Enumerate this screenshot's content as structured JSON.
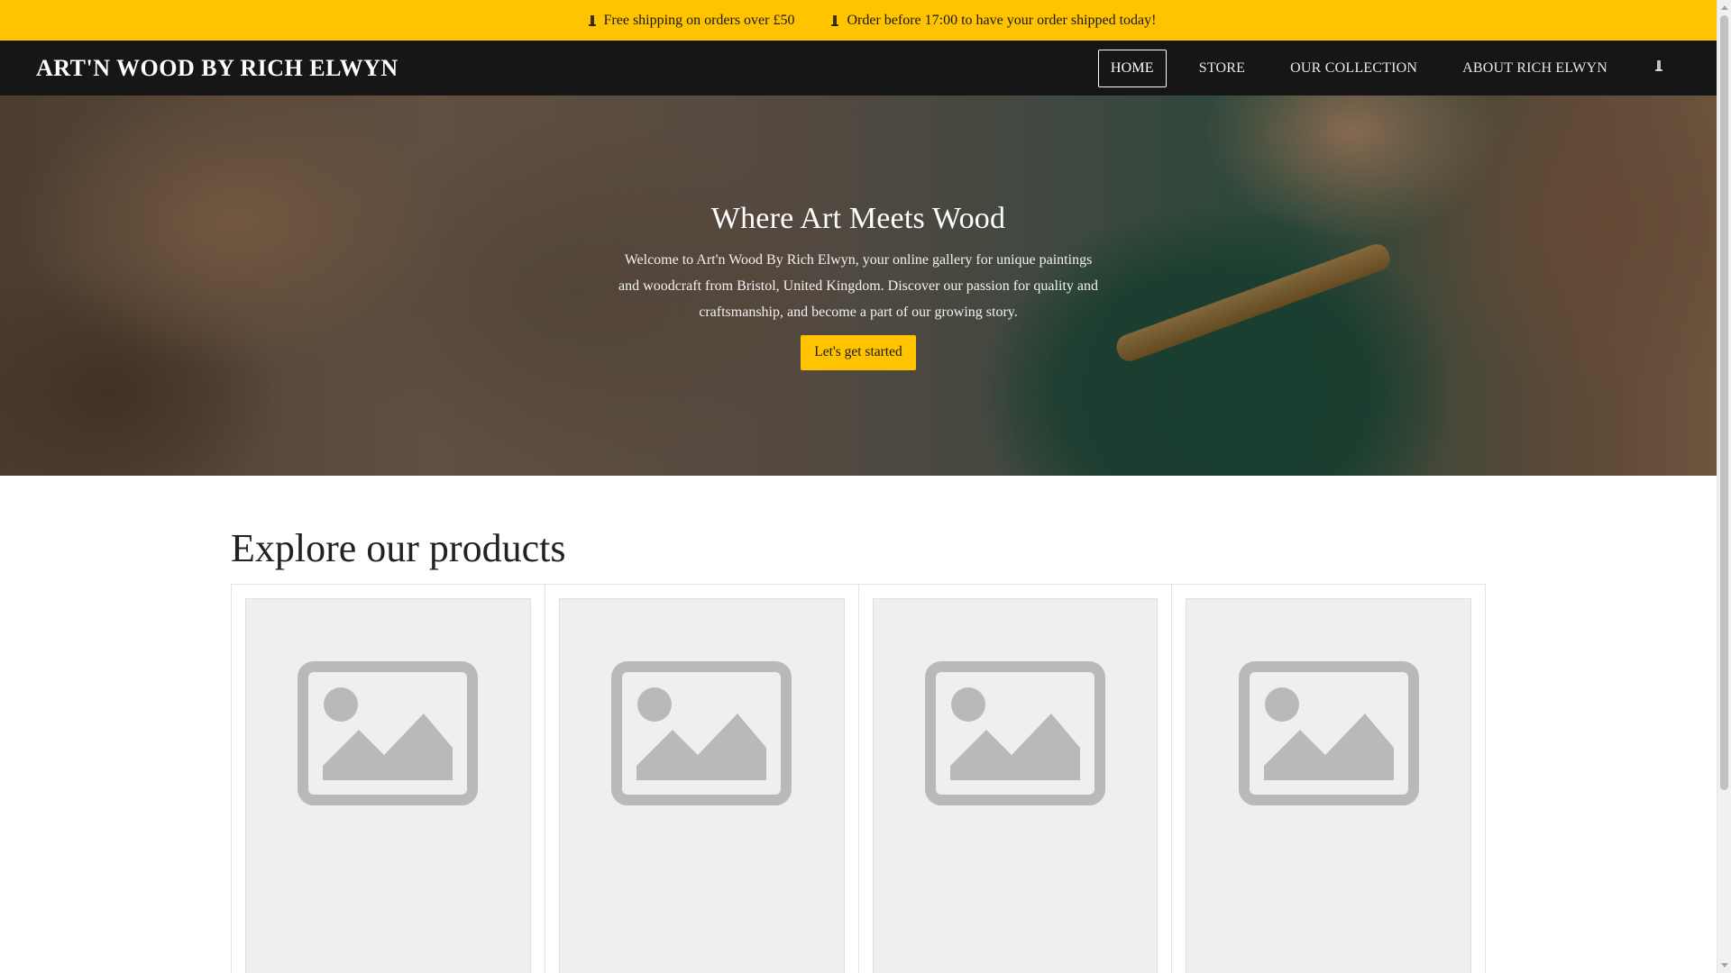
{
  "announcement": {
    "items": [
      {
        "icon": "shipping-icon",
        "text": "Free shipping on orders over £50"
      },
      {
        "icon": "clock-icon",
        "text": "Order before 17:00 to have your order shipped today!"
      }
    ],
    "background": "#ffc300"
  },
  "header": {
    "brand": "ART'N WOOD BY RICH ELWYN",
    "nav": [
      {
        "label": "HOME",
        "active": true
      },
      {
        "label": "STORE",
        "active": false
      },
      {
        "label": "OUR COLLECTION",
        "active": false
      },
      {
        "label": "ABOUT RICH ELWYN",
        "active": false
      }
    ],
    "search_icon": "search-icon",
    "background": "#161616"
  },
  "hero": {
    "title": "Where Art Meets Wood",
    "text": "Welcome to Art'n Wood By Rich Elwyn, your online gallery for unique paintings and woodcraft from Bristol, United Kingdom. Discover our passion for quality and craftsmanship, and become a part of our growing story.",
    "cta_label": "Let's get started",
    "cta_color": "#ffc300"
  },
  "products": {
    "title": "Explore our products",
    "cards": [
      {
        "image_icon": "image-placeholder-icon"
      },
      {
        "image_icon": "image-placeholder-icon"
      },
      {
        "image_icon": "image-placeholder-icon"
      },
      {
        "image_icon": "image-placeholder-icon"
      }
    ]
  }
}
